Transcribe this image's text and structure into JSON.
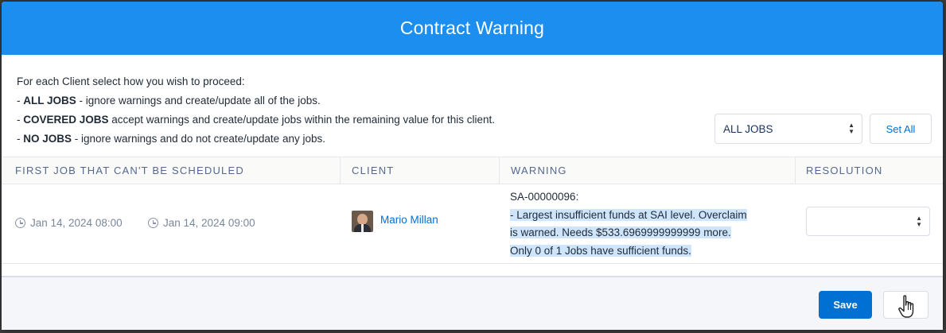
{
  "dialog": {
    "title": "Contract Warning"
  },
  "instructions": {
    "intro": "For each Client select how you wish to proceed:",
    "items": [
      {
        "prefix": "- ",
        "bold": "ALL JOBS",
        "text": " - ignore warnings and create/update all of the jobs."
      },
      {
        "prefix": "- ",
        "bold": "COVERED JOBS",
        "text": " accept warnings and create/update jobs within the remaining value for this client."
      },
      {
        "prefix": "- ",
        "bold": "NO JOBS",
        "text": " - ignore warnings and do not create/update any jobs."
      }
    ]
  },
  "bulk": {
    "selected": "ALL JOBS",
    "set_all_label": "Set All"
  },
  "table": {
    "columns": [
      "FIRST JOB THAT CAN'T BE SCHEDULED",
      "CLIENT",
      "WARNING",
      "RESOLUTION"
    ],
    "rows": [
      {
        "start": "Jan 14, 2024 08:00",
        "end": "Jan 14, 2024 09:00",
        "client": "Mario Millan",
        "warning_id": "SA-00000096:",
        "warning_line1": "- Largest insufficient funds at SAI level. Overclaim",
        "warning_line2": "is warned. Needs $533.6969999999999 more.",
        "warning_line3": "Only 0 of 1 Jobs have sufficient funds.",
        "resolution": ""
      }
    ]
  },
  "footer": {
    "save_label": "Save",
    "next_label": ""
  },
  "colors": {
    "header": "#1b8ef0",
    "brand_button": "#0070d2",
    "link": "#0070d2",
    "highlight": "#cfe5fb"
  },
  "icons": [
    "clock-icon",
    "avatar",
    "spinner-icon",
    "pointer-cursor-icon"
  ]
}
